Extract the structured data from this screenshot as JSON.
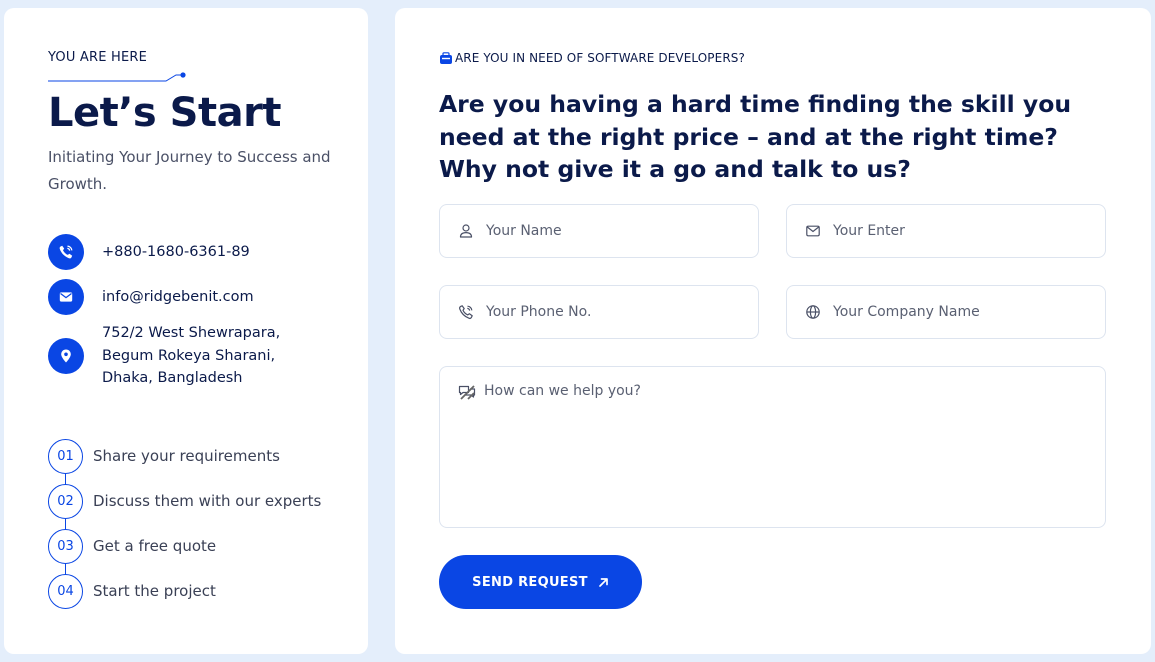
{
  "left": {
    "eyebrow": "YOU ARE HERE",
    "heading": "Let’s Start",
    "subtext": "Initiating Your Journey to Success and Growth.",
    "contacts": {
      "phone": {
        "icon": "phone-icon",
        "text": "+880-1680-6361-89"
      },
      "email": {
        "icon": "mail-icon",
        "text": "info@ridgebenit.com"
      },
      "address": {
        "icon": "location-pin-icon",
        "text": "752/2 West Shewrapara,\nBegum Rokeya Sharani,\nDhaka, Bangladesh"
      }
    },
    "steps": [
      {
        "num": "01",
        "label": "Share your requirements"
      },
      {
        "num": "02",
        "label": "Discuss them with our experts"
      },
      {
        "num": "03",
        "label": "Get a free quote"
      },
      {
        "num": "04",
        "label": "Start the project"
      }
    ]
  },
  "right": {
    "tag": "ARE YOU IN NEED OF SOFTWARE DEVELOPERS?",
    "question": "Are you having a hard time finding the skill you need at the right price – and at the right time? Why not give it a go and talk to us?",
    "form": {
      "name_placeholder": "Your Name",
      "email_placeholder": "Your Enter",
      "phone_placeholder": "Your Phone No.",
      "company_placeholder": "Your Company Name",
      "message_placeholder": "How can we help you?",
      "name_value": "",
      "email_value": "",
      "phone_value": "",
      "company_value": "",
      "message_value": ""
    },
    "send_label": "SEND REQUEST"
  },
  "colors": {
    "accent": "#0a46e4",
    "heading": "#0b1a4a",
    "background": "#e4eefb"
  }
}
